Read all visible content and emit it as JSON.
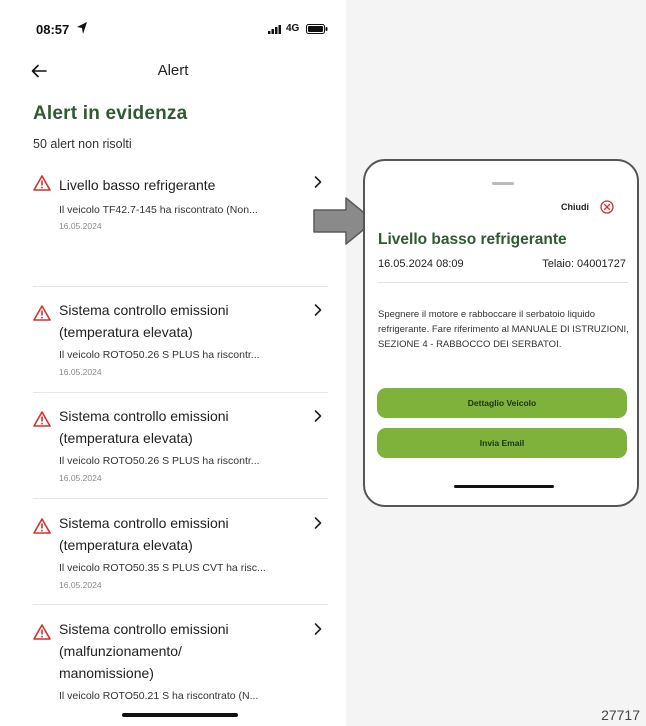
{
  "status_bar": {
    "time": "08:57",
    "network": "4G"
  },
  "nav": {
    "title": "Alert"
  },
  "section": {
    "title": "Alert in evidenza",
    "unresolved": "50 alert non risolti"
  },
  "alerts": [
    {
      "title": "Livello basso refrigerante",
      "desc": "Il veicolo TF42.7-145 ha riscontrato (Non...",
      "date": "16.05.2024"
    },
    {
      "title": "Sistema controllo emissioni (temperatura elevata)",
      "desc": "Il veicolo ROTO50.26 S PLUS ha riscontr...",
      "date": "16.05.2024"
    },
    {
      "title": "Sistema controllo emissioni (temperatura elevata)",
      "desc": "Il veicolo ROTO50.26 S PLUS ha riscontr...",
      "date": "16.05.2024"
    },
    {
      "title": "Sistema controllo emissioni (temperatura elevata)",
      "desc": "Il veicolo ROTO50.35 S PLUS CVT ha risc...",
      "date": "16.05.2024"
    },
    {
      "title": "Sistema controllo emissioni (malfunzionamento/ manomissione)",
      "desc": "Il veicolo ROTO50.21 S ha riscontrato (N...",
      "date": ""
    }
  ],
  "detail": {
    "close_label": "Chiudi",
    "title": "Livello basso refrigerante",
    "datetime": "16.05.2024 08:09",
    "chassis": "Telaio: 04001727",
    "body": "Spegnere il motore e rabboccare il serbatoio liquido refrigerante. Fare riferimento al MANUALE DI ISTRUZIONI, SEZIONE 4 - RABBOCCO DEI SERBATOI.",
    "btn_vehicle": "Dettaglio Veicolo",
    "btn_email": "Invia Email"
  },
  "figure_id": "27717",
  "colors": {
    "accent_green": "#2f5a32",
    "button_green": "#7fb23a",
    "warning_red": "#d0322e"
  },
  "icons": [
    "location-arrow-icon",
    "signal-icon",
    "battery-icon",
    "back-arrow-icon",
    "warning-icon",
    "chevron-right-icon",
    "close-circle-icon",
    "pointer-arrow-icon"
  ]
}
